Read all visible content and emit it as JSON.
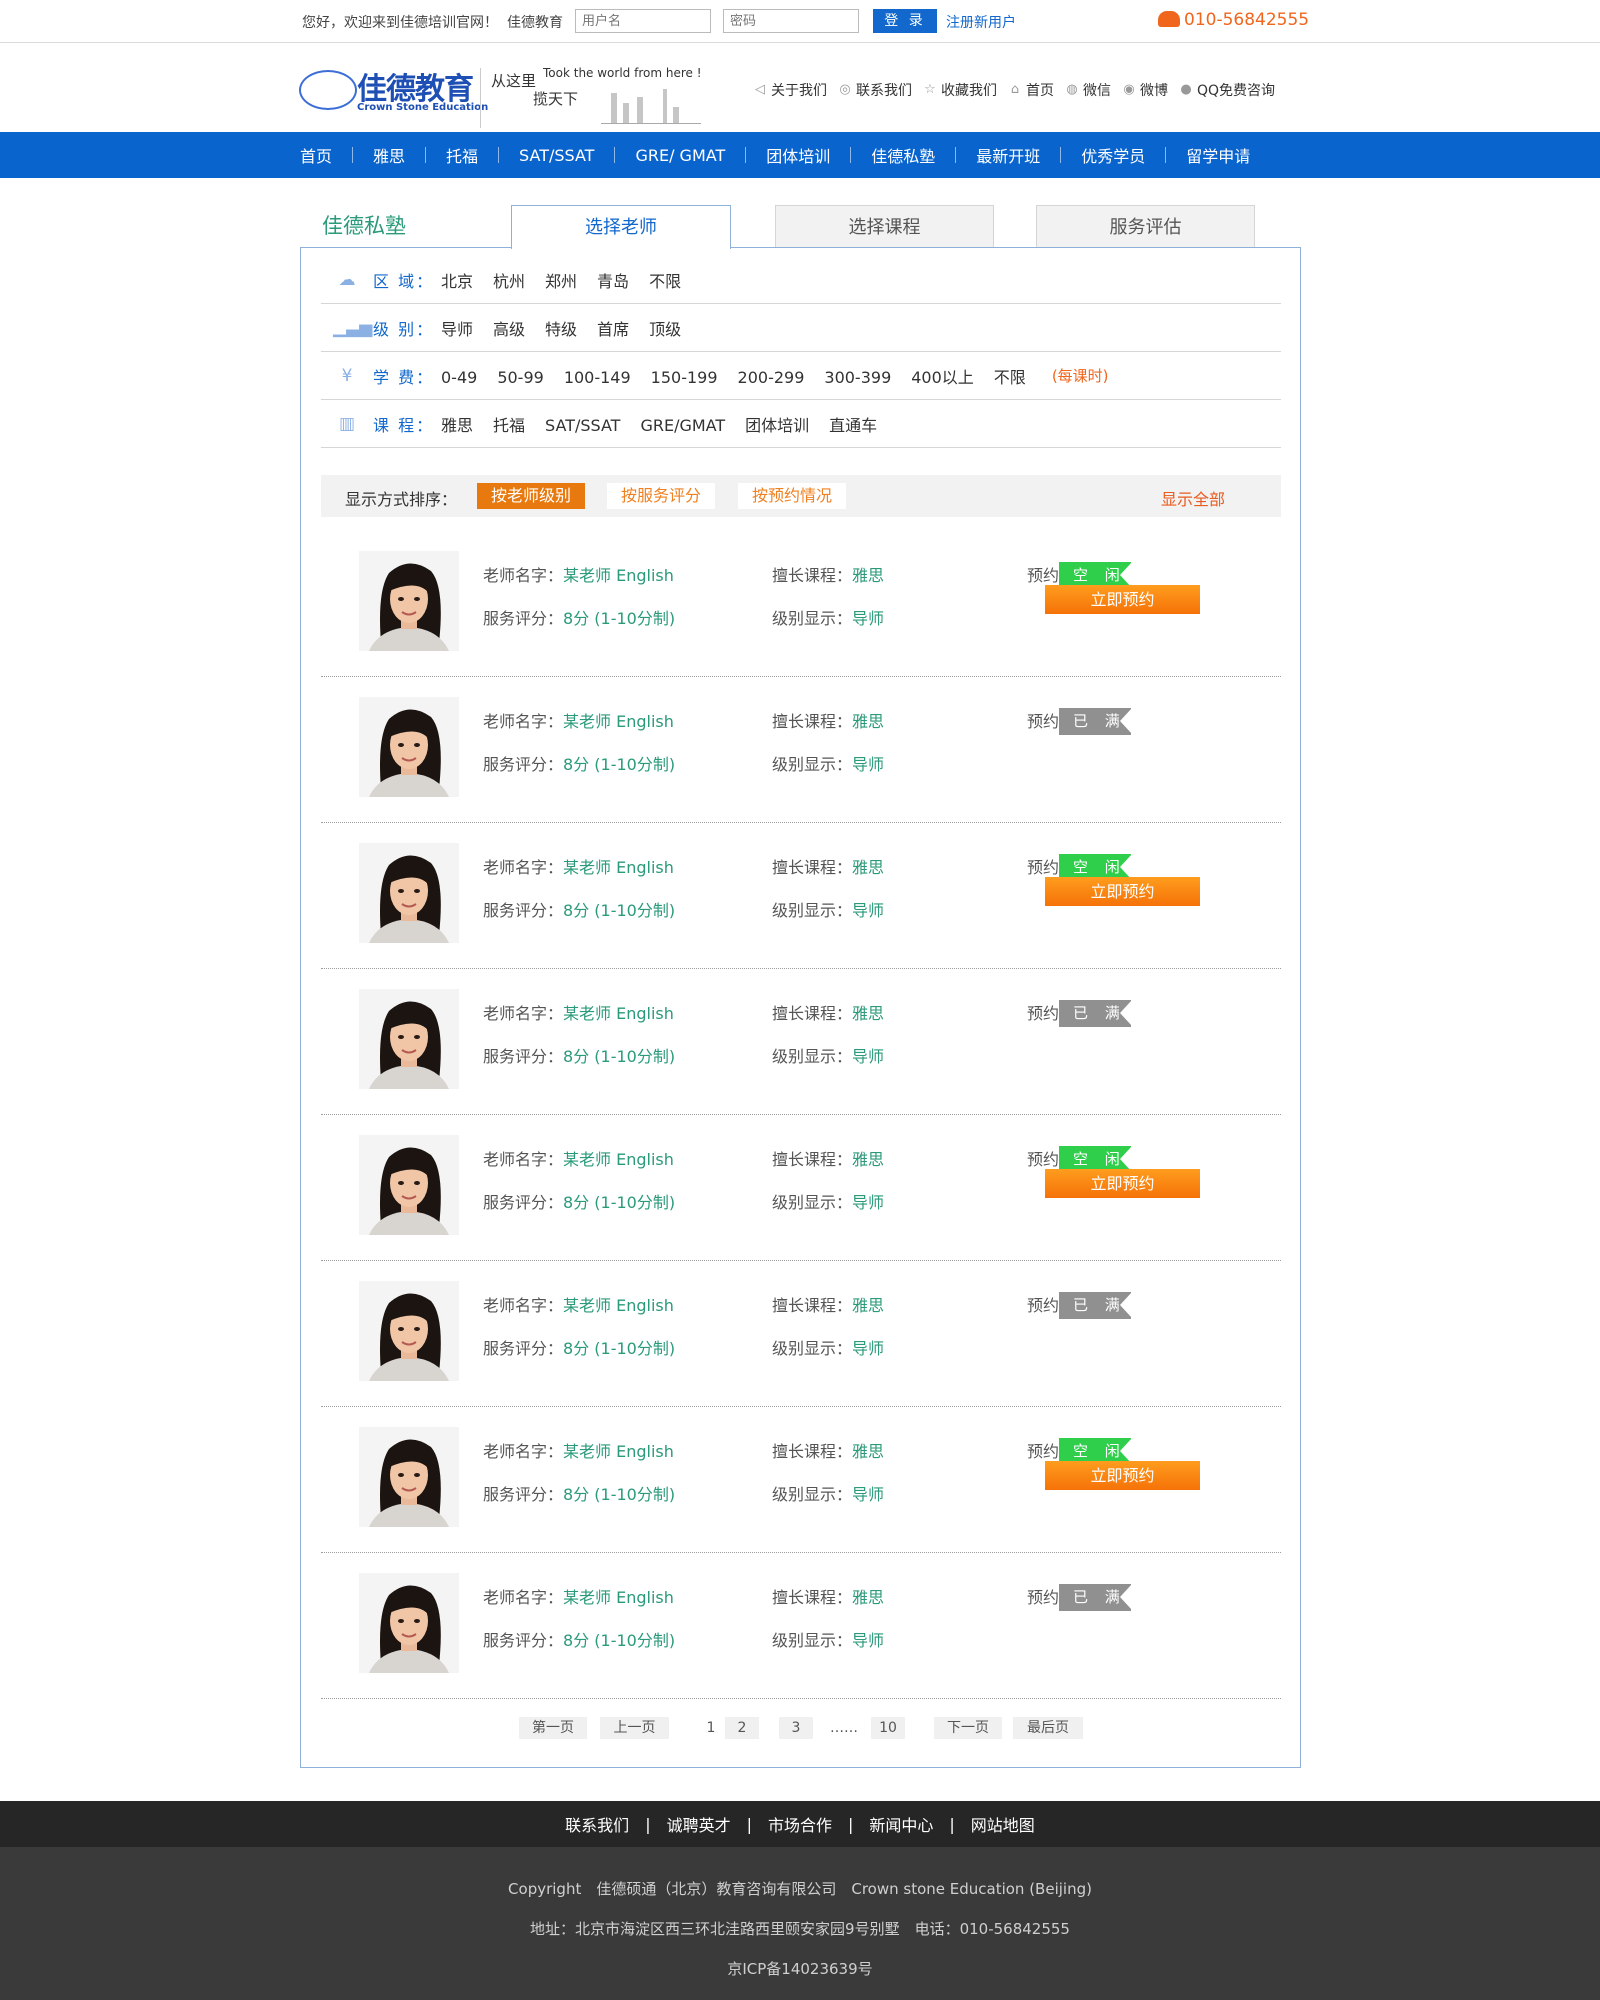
{
  "topbar": {
    "welcome": "您好，欢迎来到佳德培训官网！",
    "brand": "佳德教育",
    "username_placeholder": "用户名",
    "password_placeholder": "密码",
    "login": "登 录",
    "register": "注册新用户",
    "phone": "010-56842555"
  },
  "header": {
    "logo_cn": "佳德教育",
    "logo_en": "Crown Stone Education",
    "slogan_cn_1": "从这里",
    "slogan_en": "Took the world from here !",
    "slogan_cn_2": "揽天下",
    "links": [
      "关于我们",
      "联系我们",
      "收藏我们",
      "首页",
      "微信",
      "微博",
      "QQ免费咨询"
    ]
  },
  "nav": [
    "首页",
    "雅思",
    "托福",
    "SAT/SSAT",
    "GRE/ GMAT",
    "团体培训",
    "佳德私塾",
    "最新开班",
    "优秀学员",
    "留学申请"
  ],
  "page_title": "佳德私塾",
  "tabs": [
    "选择老师",
    "选择课程",
    "服务评估"
  ],
  "filters": {
    "region": {
      "label": "区 域：",
      "options": [
        "北京",
        "杭州",
        "郑州",
        "青岛",
        "不限"
      ]
    },
    "level": {
      "label": "级 别：",
      "options": [
        "导师",
        "高级",
        "特级",
        "首席",
        "顶级"
      ]
    },
    "fee": {
      "label": "学 费：",
      "options": [
        "0-49",
        "50-99",
        "100-149",
        "150-199",
        "200-299",
        "300-399",
        "400以上",
        "不限"
      ],
      "note": "(每课时)"
    },
    "course": {
      "label": "课 程：",
      "options": [
        "雅思",
        "托福",
        "SAT/SSAT",
        "GRE/GMAT",
        "团体培训",
        "直通车"
      ]
    }
  },
  "sort": {
    "label": "显示方式排序：",
    "options": [
      "按老师级别",
      "按服务评分",
      "按预约情况"
    ],
    "show_all": "显示全部"
  },
  "labels": {
    "name": "老师名字：",
    "subject": "擅长课程：",
    "booking": "预约情况：",
    "rating": "服务评分：",
    "level": "级别显示：",
    "book_button": "立即预约"
  },
  "teachers": [
    {
      "name": "某老师 English",
      "subject": "雅思",
      "status": "空 闲",
      "rating": "8分 (1-10分制)",
      "level": "导师"
    },
    {
      "name": "某老师 English",
      "subject": "雅思",
      "status": "已 满",
      "rating": "8分 (1-10分制)",
      "level": "导师"
    },
    {
      "name": "某老师 English",
      "subject": "雅思",
      "status": "空 闲",
      "rating": "8分 (1-10分制)",
      "level": "导师"
    },
    {
      "name": "某老师 English",
      "subject": "雅思",
      "status": "已 满",
      "rating": "8分 (1-10分制)",
      "level": "导师"
    },
    {
      "name": "某老师 English",
      "subject": "雅思",
      "status": "空 闲",
      "rating": "8分 (1-10分制)",
      "level": "导师"
    },
    {
      "name": "某老师 English",
      "subject": "雅思",
      "status": "已 满",
      "rating": "8分 (1-10分制)",
      "level": "导师"
    },
    {
      "name": "某老师 English",
      "subject": "雅思",
      "status": "空 闲",
      "rating": "8分 (1-10分制)",
      "level": "导师"
    },
    {
      "name": "某老师 English",
      "subject": "雅思",
      "status": "已 满",
      "rating": "8分 (1-10分制)",
      "level": "导师"
    }
  ],
  "pager": {
    "first": "第一页",
    "prev": "上一页",
    "pages": [
      "1",
      "2",
      "3"
    ],
    "ellipsis": "……",
    "last_num": "10",
    "next": "下一页",
    "last": "最后页"
  },
  "footer": {
    "links": [
      "联系我们",
      "诚聘英才",
      "市场合作",
      "新闻中心",
      "网站地图"
    ],
    "sep": "|",
    "copyright": "Copyright　佳德硕通（北京）教育咨询有限公司　Crown stone Education (Beijing)",
    "address": "地址：北京市海淀区西三环北洼路西里颐安家园9号别墅　电话：010-56842555",
    "icp": "京ICP备14023639号"
  },
  "colors": {
    "nav_blue": "#0a64ce",
    "accent_green": "#2a9a7a",
    "orange": "#f57208",
    "free_green": "#2fcf4b",
    "full_gray": "#909090"
  }
}
